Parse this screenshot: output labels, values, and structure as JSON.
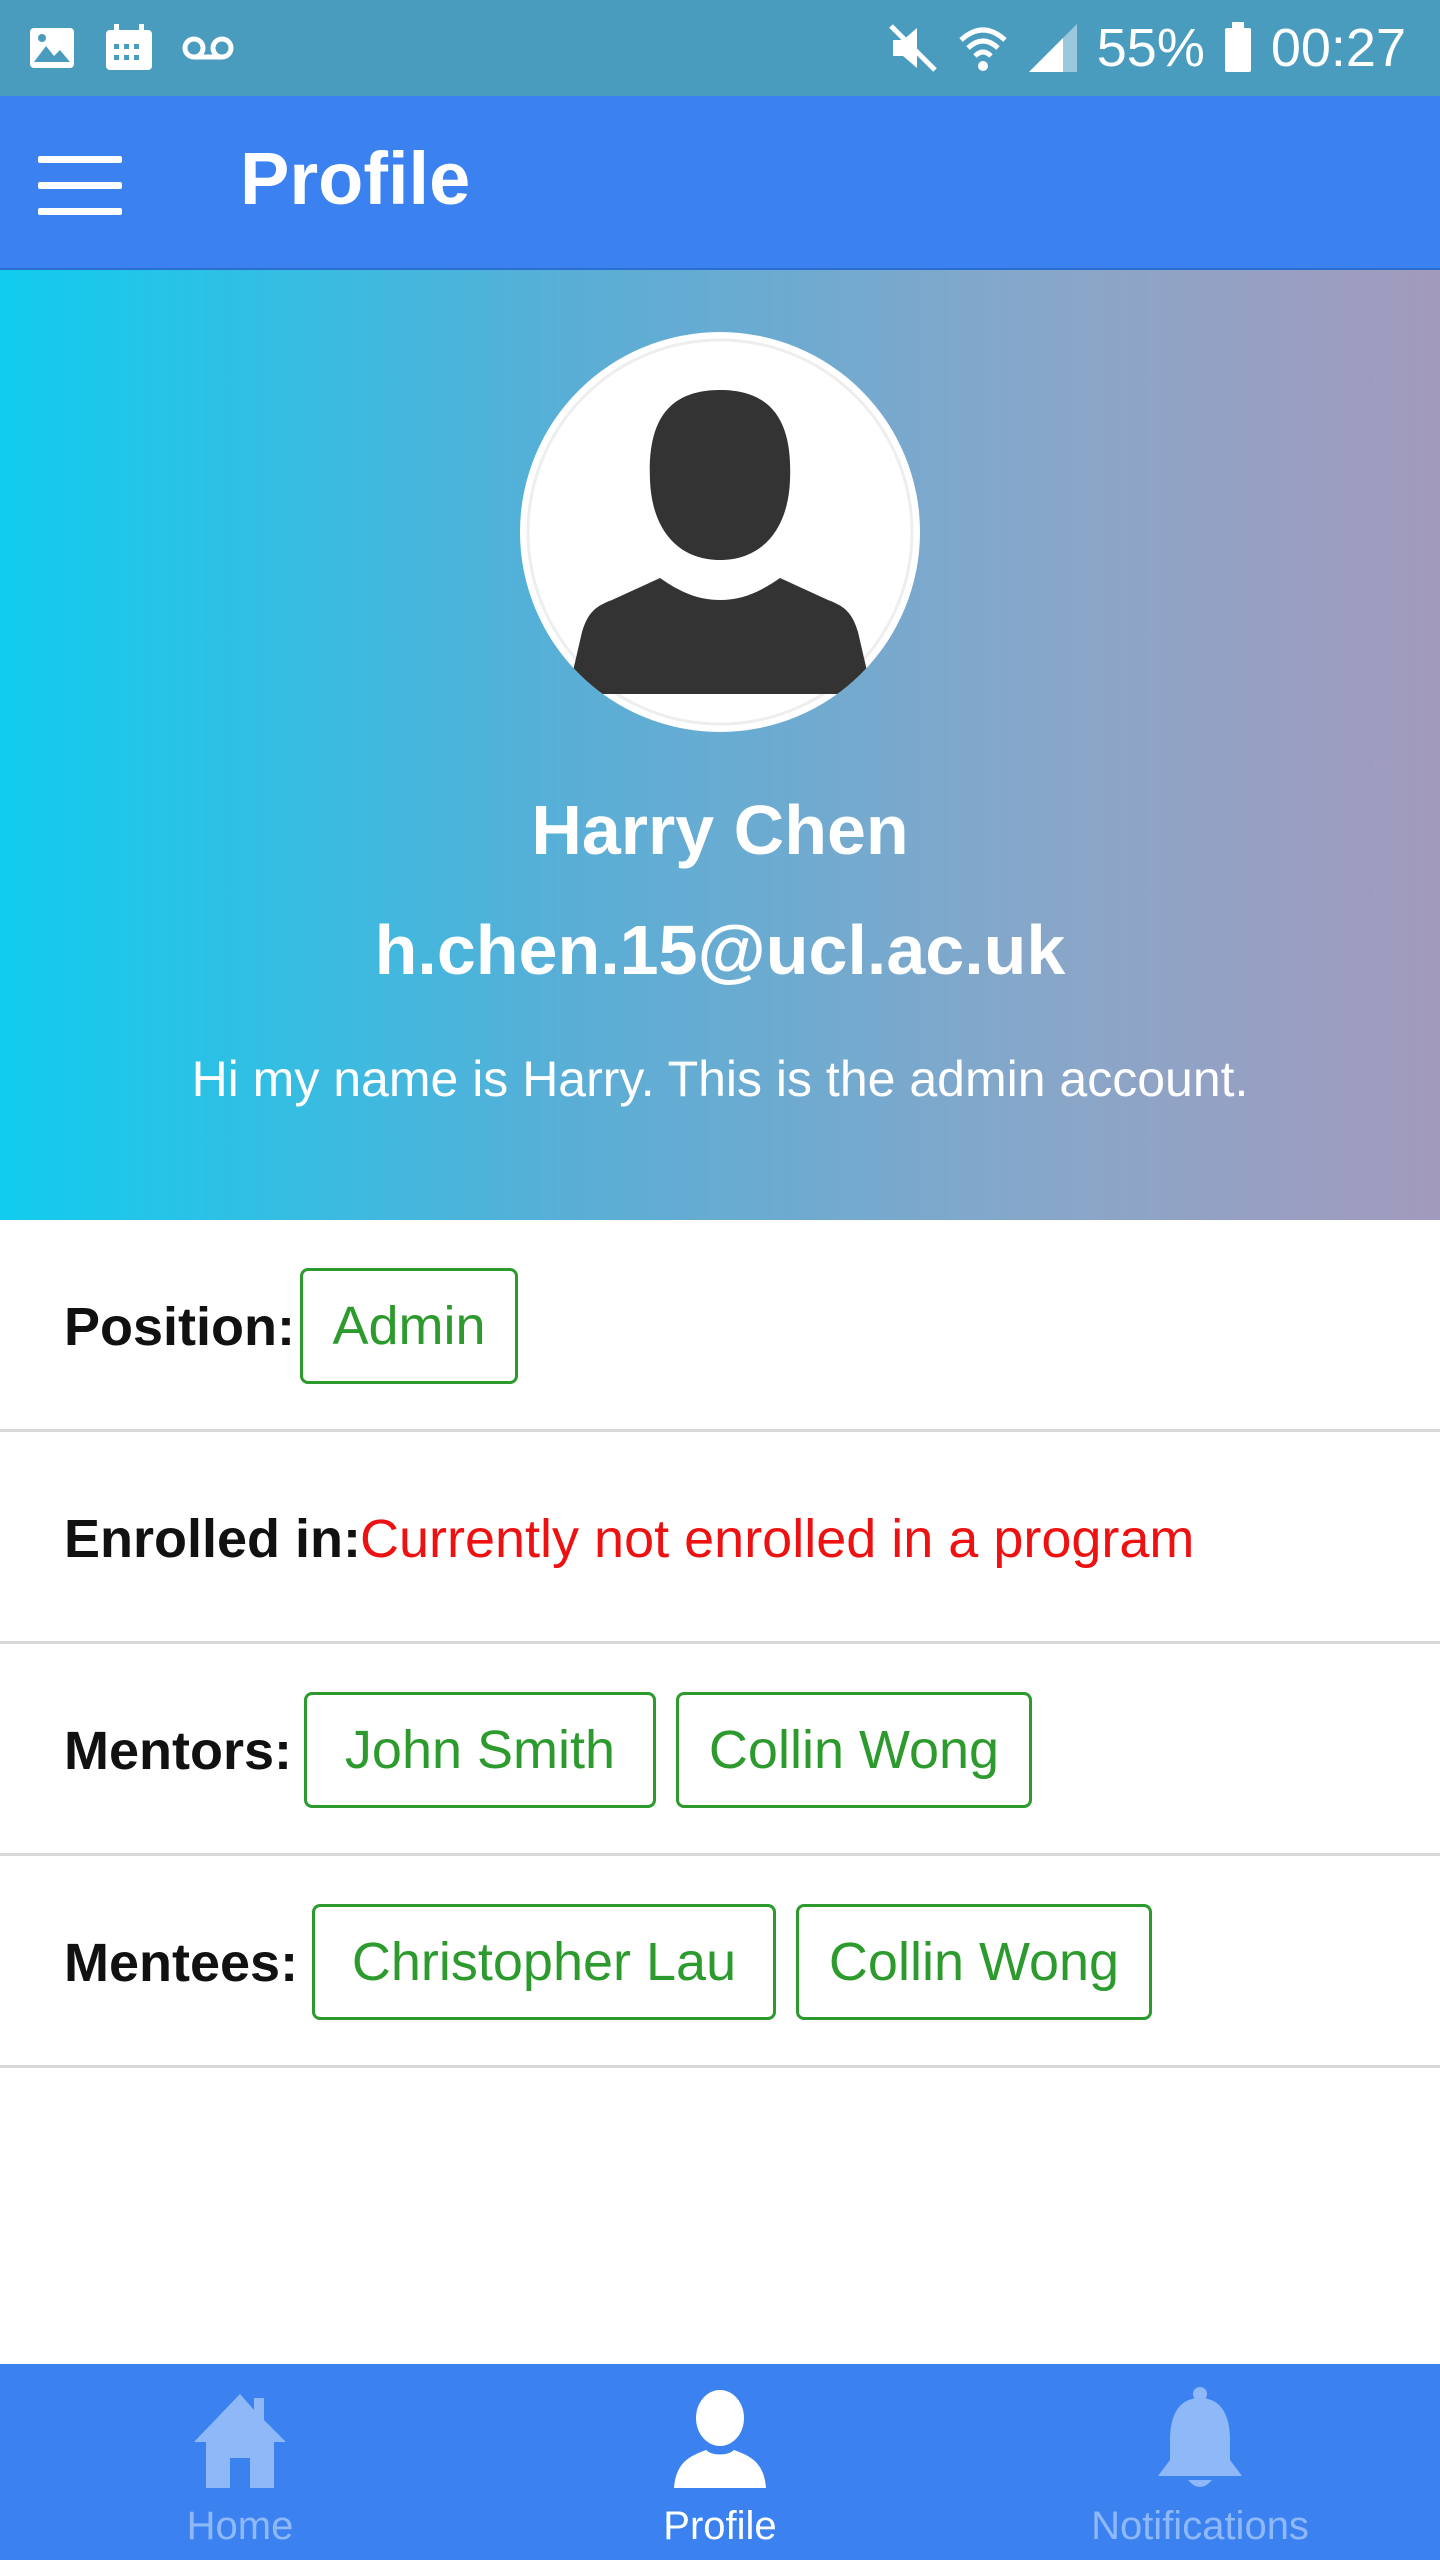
{
  "status_bar": {
    "battery": "55%",
    "time": "00:27",
    "left_icons": [
      "gallery-icon",
      "calendar-icon",
      "voicemail-icon"
    ],
    "right_icons": [
      "mute-icon",
      "wifi-icon",
      "signal-icon",
      "battery-icon"
    ]
  },
  "app_bar": {
    "title": "Profile",
    "color": "#3b82f0"
  },
  "profile": {
    "name": "Harry Chen",
    "email": "h.chen.15@ucl.ac.uk",
    "bio": "Hi my name is Harry. This is the admin account."
  },
  "details": {
    "position": {
      "label": "Position:",
      "tags": [
        "Admin"
      ]
    },
    "enrolled": {
      "label": "Enrolled in:",
      "value": "Currently not enrolled in a program"
    },
    "mentors": {
      "label": "Mentors:",
      "tags": [
        "John Smith",
        "Collin Wong"
      ]
    },
    "mentees": {
      "label": "Mentees:",
      "tags": [
        "Christopher Lau",
        "Collin Wong"
      ]
    }
  },
  "bottom_nav": {
    "items": [
      {
        "label": "Home",
        "icon": "home-icon",
        "active": false
      },
      {
        "label": "Profile",
        "icon": "profile-icon",
        "active": true
      },
      {
        "label": "Notifications",
        "icon": "bell-icon",
        "active": false
      }
    ]
  },
  "colors": {
    "tag_green": "#2d9a2d",
    "warning_red": "#ee1111",
    "nav_inactive": "#8fb8f8"
  }
}
